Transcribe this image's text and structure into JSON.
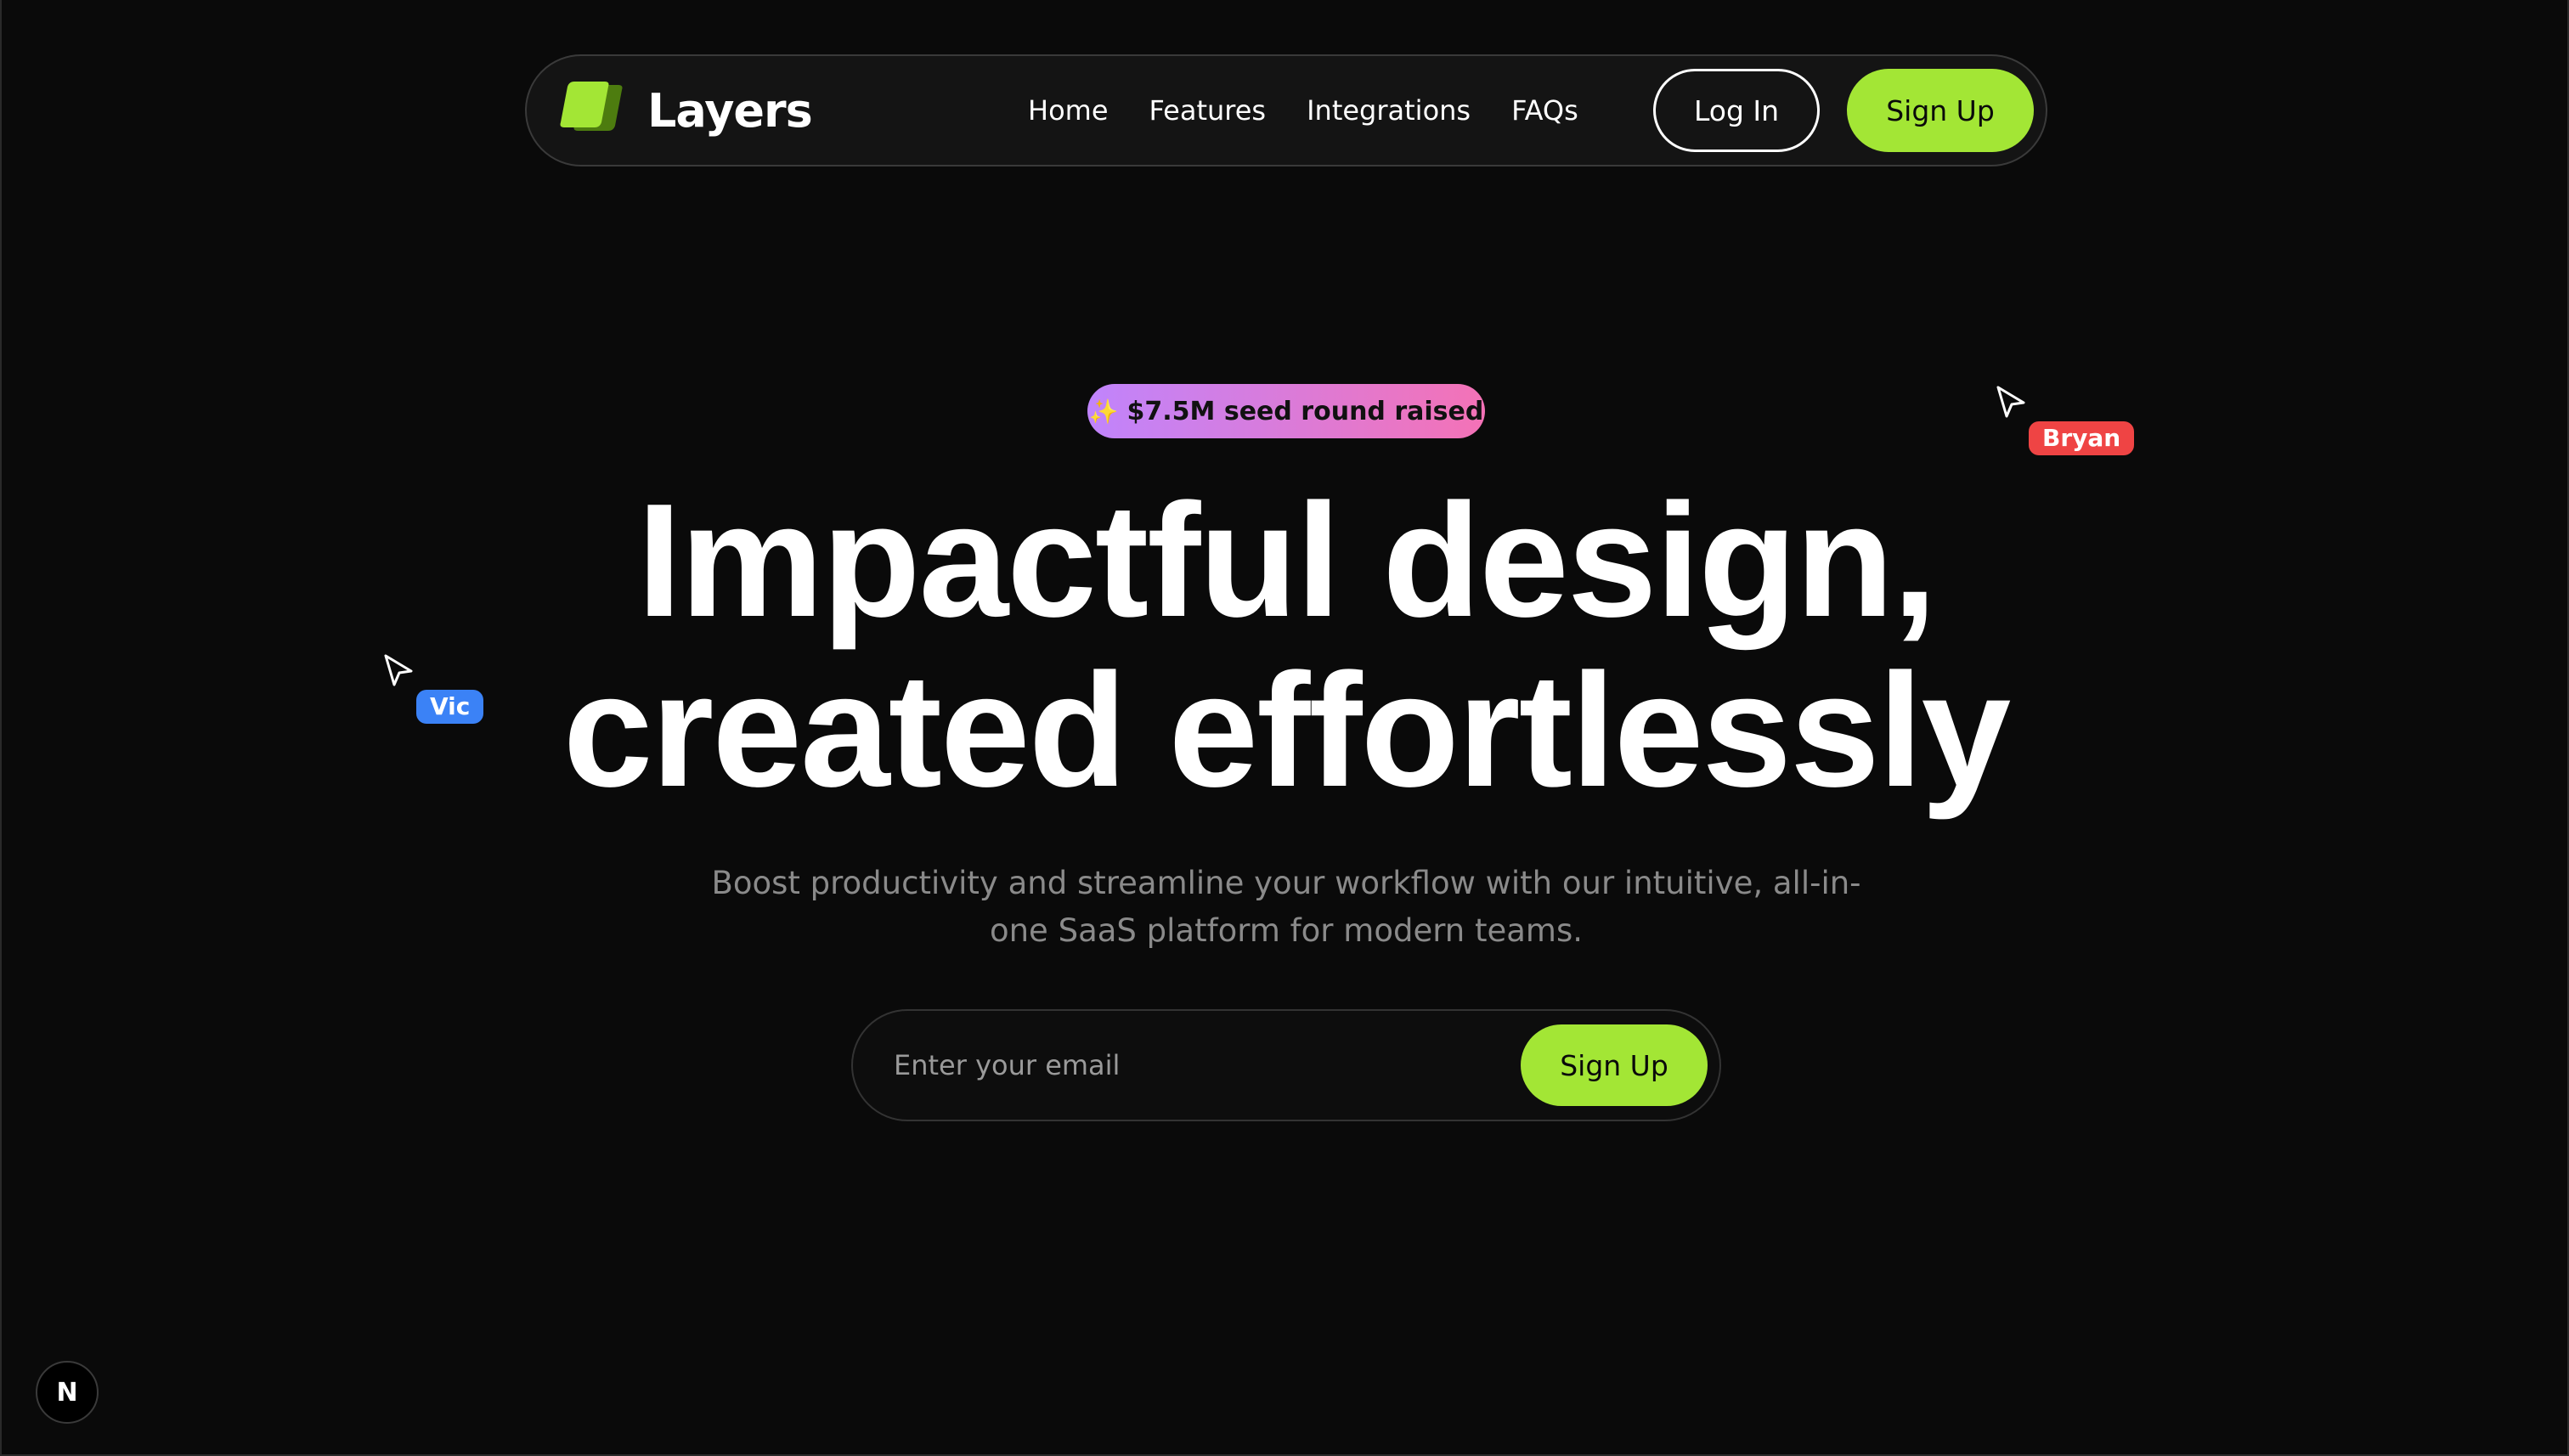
{
  "brand": {
    "name": "Layers",
    "accent": "#a3e635"
  },
  "nav": {
    "links": [
      {
        "label": "Home"
      },
      {
        "label": "Features"
      },
      {
        "label": "Integrations"
      },
      {
        "label": "FAQs"
      }
    ],
    "login_label": "Log In",
    "signup_label": "Sign Up"
  },
  "badge": {
    "icon": "sparkle-icon",
    "text": "$7.5M seed round raised"
  },
  "hero": {
    "title_line1": "Impactful design,",
    "title_line2": "created effortlessly",
    "subtitle": "Boost productivity and streamline your workflow with our intuitive, all-in-one SaaS platform for modern teams."
  },
  "form": {
    "email_placeholder": "Enter your email",
    "signup_label": "Sign Up"
  },
  "cursors": [
    {
      "name": "Bryan",
      "color": "#ef4444"
    },
    {
      "name": "Vic",
      "color": "#3b82f6"
    }
  ],
  "dev_badge": {
    "letter": "N"
  }
}
